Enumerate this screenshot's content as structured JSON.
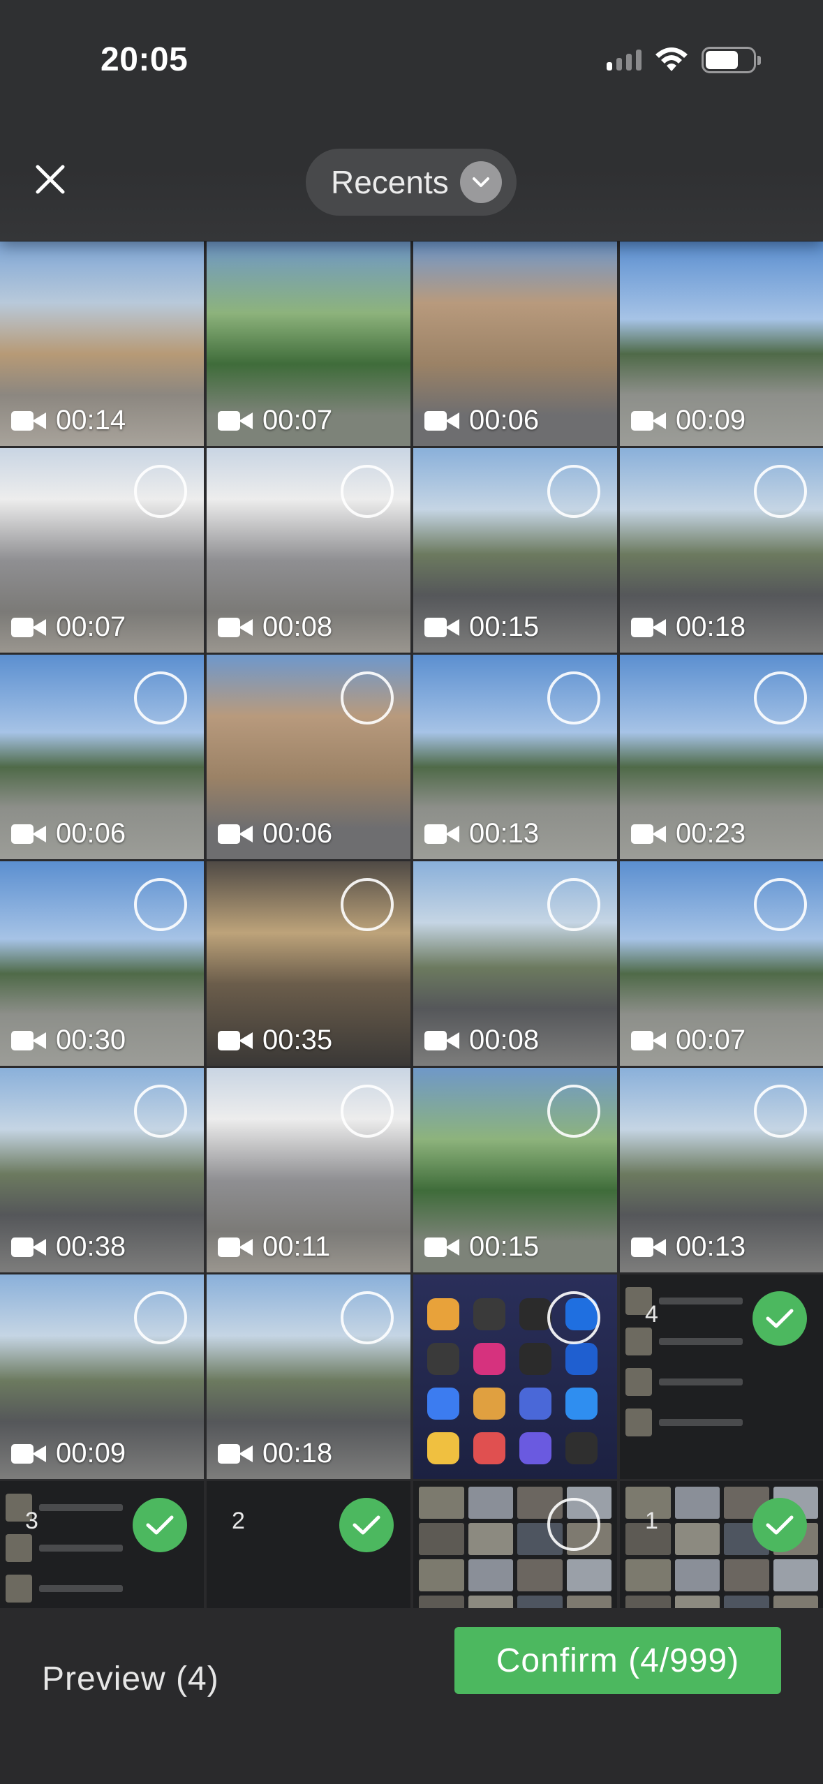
{
  "status_bar": {
    "time": "20:05"
  },
  "header": {
    "album_label": "Recents"
  },
  "tiles": [
    {
      "duration": "00:14",
      "style": "sky-warm",
      "state": "none"
    },
    {
      "duration": "00:07",
      "style": "sky-tree",
      "state": "none"
    },
    {
      "duration": "00:06",
      "style": "sky-fort",
      "state": "none"
    },
    {
      "duration": "00:09",
      "style": "sky-blue",
      "state": "none"
    },
    {
      "duration": "00:07",
      "style": "sky-city",
      "state": "ring"
    },
    {
      "duration": "00:08",
      "style": "sky-city",
      "state": "ring"
    },
    {
      "duration": "00:15",
      "style": "sky-street",
      "state": "ring"
    },
    {
      "duration": "00:18",
      "style": "sky-street",
      "state": "ring"
    },
    {
      "duration": "00:06",
      "style": "sky-blue",
      "state": "ring"
    },
    {
      "duration": "00:06",
      "style": "sky-fort",
      "state": "ring"
    },
    {
      "duration": "00:13",
      "style": "sky-blue",
      "state": "ring"
    },
    {
      "duration": "00:23",
      "style": "sky-blue",
      "state": "ring"
    },
    {
      "duration": "00:30",
      "style": "sky-blue",
      "state": "ring"
    },
    {
      "duration": "00:35",
      "style": "sky-dark",
      "state": "ring"
    },
    {
      "duration": "00:08",
      "style": "sky-street",
      "state": "ring"
    },
    {
      "duration": "00:07",
      "style": "sky-blue",
      "state": "ring"
    },
    {
      "duration": "00:38",
      "style": "sky-street",
      "state": "ring"
    },
    {
      "duration": "00:11",
      "style": "sky-city",
      "state": "ring"
    },
    {
      "duration": "00:15",
      "style": "sky-tree",
      "state": "ring"
    },
    {
      "duration": "00:13",
      "style": "sky-street",
      "state": "ring"
    },
    {
      "duration": "00:09",
      "style": "sky-street",
      "state": "ring"
    },
    {
      "duration": "00:18",
      "style": "sky-street",
      "state": "ring"
    },
    {
      "duration": "",
      "style": "screen-apps",
      "state": "ring",
      "content": "apps"
    },
    {
      "duration": "",
      "style": "screen-dark",
      "state": "check",
      "order": "4",
      "content": "list"
    },
    {
      "duration": "",
      "style": "screen-dark",
      "state": "check",
      "order": "3",
      "content": "list"
    },
    {
      "duration": "",
      "style": "screen-dark",
      "state": "check",
      "order": "2",
      "content": "dark"
    },
    {
      "duration": "",
      "style": "screen-dark",
      "state": "ring",
      "content": "mosaic"
    },
    {
      "duration": "",
      "style": "screen-dark",
      "state": "check",
      "order": "1",
      "content": "mosaic"
    }
  ],
  "footer": {
    "preview_label": "Preview (4)",
    "confirm_label": "Confirm (4/999)"
  },
  "colors": {
    "accent": "#4cb85f",
    "background": "#2a2a2c"
  }
}
